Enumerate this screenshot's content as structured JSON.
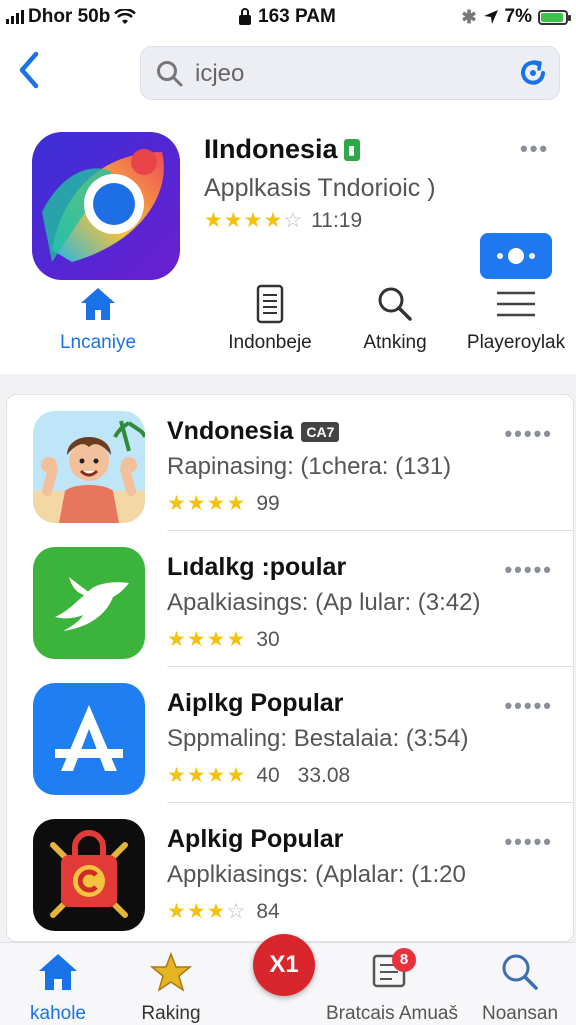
{
  "status_bar": {
    "carrier": "Dhor 50b",
    "time": "163 PAM",
    "battery": "7%"
  },
  "header": {
    "search_value": "icjeo"
  },
  "featured": {
    "title": "IIndonesia",
    "subtitle": "Applkasis Tndorioic )",
    "rating_value": "11:19",
    "tabs": [
      {
        "label": "Lncaniye"
      },
      {
        "label": "Indonbeje"
      },
      {
        "label": "Atnking"
      },
      {
        "label": "Playeroylak"
      }
    ]
  },
  "apps": [
    {
      "title": "Vndonesia",
      "tag": "CA7",
      "subtitle": "Rapinasing: (1chera: (131)",
      "rating": "99"
    },
    {
      "title": "Lıdalkg :poular",
      "subtitle": "Apalkiasings: (Ap lular: (3:42)",
      "rating": "30"
    },
    {
      "title": "Aiplkg Popular",
      "subtitle": "Sppmaling: Bestalaia: (3:54)",
      "rating": "40",
      "extra": "33.08"
    },
    {
      "title": "Aplkig Popular",
      "subtitle": "Applkiasings: (Aplalar: (1:20",
      "rating": "84"
    }
  ],
  "fab_label": "X1",
  "bottom_nav": [
    {
      "label": "kahole"
    },
    {
      "label": "Raking"
    },
    {
      "label": "Bratcais Amuaš",
      "badge": "8"
    },
    {
      "label": "Noansan"
    }
  ],
  "colors": {
    "accent": "#1a72e8",
    "star": "#f4c20d",
    "fab": "#d9262c"
  }
}
